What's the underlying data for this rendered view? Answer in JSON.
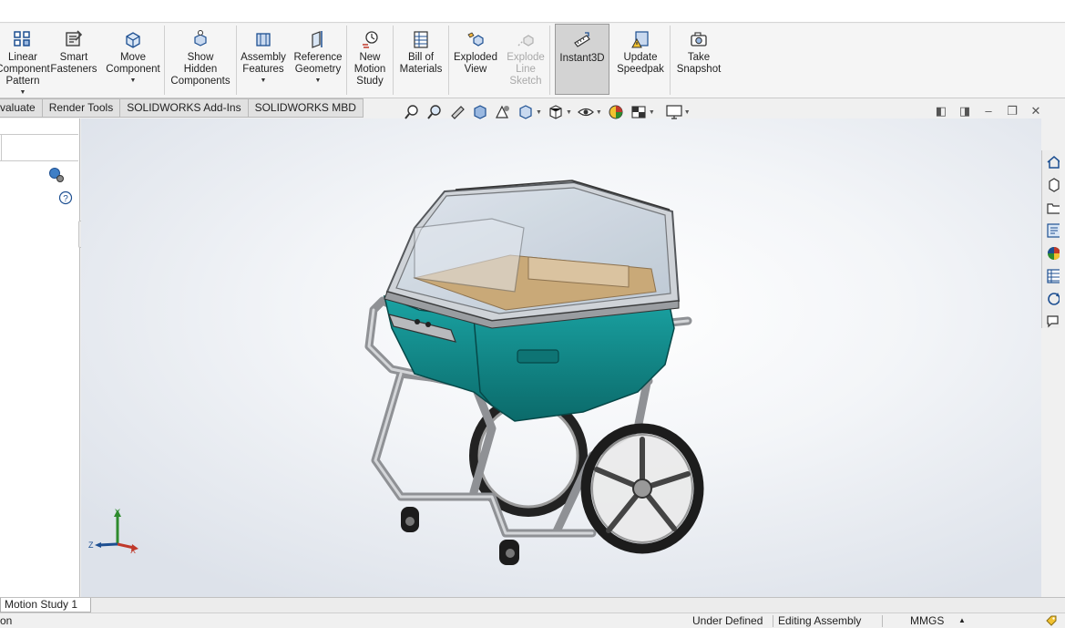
{
  "ribbon": {
    "buttons": [
      {
        "label": "Linear\nComponent\nPattern",
        "dropdown": "▼",
        "icon": "linear-pattern-icon"
      },
      {
        "label": "Smart\nFasteners",
        "icon": "smart-fasteners-icon"
      },
      {
        "label": "Move\nComponent",
        "dropdown": "▼",
        "icon": "move-component-icon"
      },
      {
        "label": "Show\nHidden\nComponents",
        "icon": "show-hidden-icon"
      },
      {
        "label": "Assembly\nFeatures",
        "dropdown": "▼",
        "icon": "assembly-features-icon"
      },
      {
        "label": "Reference\nGeometry",
        "dropdown": "▼",
        "icon": "reference-geometry-icon"
      },
      {
        "label": "New\nMotion\nStudy",
        "icon": "motion-study-icon"
      },
      {
        "label": "Bill of\nMaterials",
        "icon": "bill-of-materials-icon"
      },
      {
        "label": "Exploded\nView",
        "icon": "exploded-view-icon"
      },
      {
        "label": "Explode\nLine\nSketch",
        "icon": "explode-line-sketch-icon",
        "disabled": true
      },
      {
        "label": "Instant3D",
        "icon": "instant3d-icon",
        "active": true
      },
      {
        "label": "Update\nSpeedpak",
        "icon": "speedpak-icon"
      },
      {
        "label": "Take\nSnapshot",
        "icon": "camera-icon"
      }
    ]
  },
  "tabs": [
    {
      "label": "valuate"
    },
    {
      "label": "Render Tools"
    },
    {
      "label": "SOLIDWORKS Add-Ins"
    },
    {
      "label": "SOLIDWORKS MBD"
    }
  ],
  "triad": {
    "y": "Y",
    "z": "Z",
    "x": "X"
  },
  "motion_tab": "Motion Study 1",
  "status": {
    "left": "on",
    "definition": "Under Defined",
    "mode": "Editing Assembly",
    "units": "MMGS",
    "units_arrow": "▲"
  },
  "colors": {
    "body_teal": "#0f8080",
    "frame_gray": "#a8aaae",
    "active_button": "#d3d3d3"
  }
}
